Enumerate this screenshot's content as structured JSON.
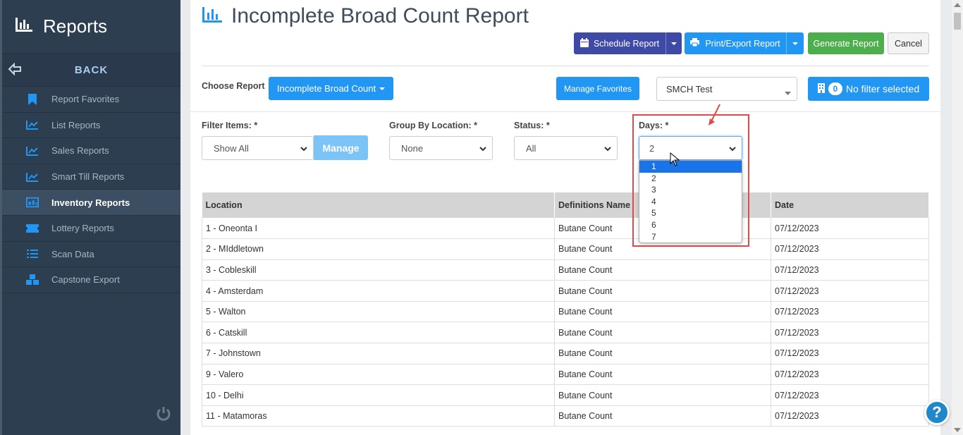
{
  "app": {
    "title": "Reports"
  },
  "sidebar": {
    "back_label": "BACK",
    "items": [
      {
        "label": "Report Favorites",
        "icon": "bookmark-icon",
        "active": false
      },
      {
        "label": "List Reports",
        "icon": "line-chart-icon",
        "active": false
      },
      {
        "label": "Sales Reports",
        "icon": "line-chart-icon",
        "active": false
      },
      {
        "label": "Smart Till Reports",
        "icon": "line-chart-icon",
        "active": false
      },
      {
        "label": "Inventory Reports",
        "icon": "inventory-icon",
        "active": true
      },
      {
        "label": "Lottery Reports",
        "icon": "ticket-icon",
        "active": false
      },
      {
        "label": "Scan Data",
        "icon": "list-icon",
        "active": false
      },
      {
        "label": "Capstone Export",
        "icon": "cubes-icon",
        "active": false
      }
    ]
  },
  "header": {
    "title": "Incomplete Broad Count Report",
    "schedule_label": "Schedule Report",
    "print_label": "Print/Export Report",
    "generate_label": "Generate Report",
    "cancel_label": "Cancel"
  },
  "controls": {
    "choose_report_label": "Choose Report",
    "report_button": "Incomplete Broad Count",
    "manage_favorites": "Manage Favorites",
    "store_select": "SMCH Test",
    "filter_count": "0",
    "filter_label": "No filter selected"
  },
  "filters": {
    "filter_items": {
      "label": "Filter Items: *",
      "value": "Show All",
      "manage": "Manage"
    },
    "group_by": {
      "label": "Group By Location: *",
      "value": "None"
    },
    "status": {
      "label": "Status: *",
      "value": "All"
    },
    "days": {
      "label": "Days: *",
      "value": "2",
      "options": [
        "1",
        "2",
        "3",
        "4",
        "5",
        "6",
        "7"
      ],
      "highlighted": "1"
    }
  },
  "table": {
    "columns": [
      "Location",
      "Definitions Name",
      "Date"
    ],
    "rows": [
      [
        "1 - Oneonta I",
        "Butane Count",
        "07/12/2023"
      ],
      [
        "2 - MIddletown",
        "Butane Count",
        "07/12/2023"
      ],
      [
        "3 - Cobleskill",
        "Butane Count",
        "07/12/2023"
      ],
      [
        "4 - Amsterdam",
        "Butane Count",
        "07/12/2023"
      ],
      [
        "5 - Walton",
        "Butane Count",
        "07/12/2023"
      ],
      [
        "6 - Catskill",
        "Butane Count",
        "07/12/2023"
      ],
      [
        "7 - Johnstown",
        "Butane Count",
        "07/12/2023"
      ],
      [
        "9 - Valero",
        "Butane Count",
        "07/12/2023"
      ],
      [
        "10 - Delhi",
        "Butane Count",
        "07/12/2023"
      ],
      [
        "11 - Matamoras",
        "Butane Count",
        "07/12/2023"
      ]
    ]
  },
  "help_label": "?",
  "colors": {
    "sidebar": "#2c3e50",
    "primary": "#2196f3",
    "navy": "#3e4aa6",
    "green": "#4cae4c",
    "highlight": "#e04a4a"
  }
}
